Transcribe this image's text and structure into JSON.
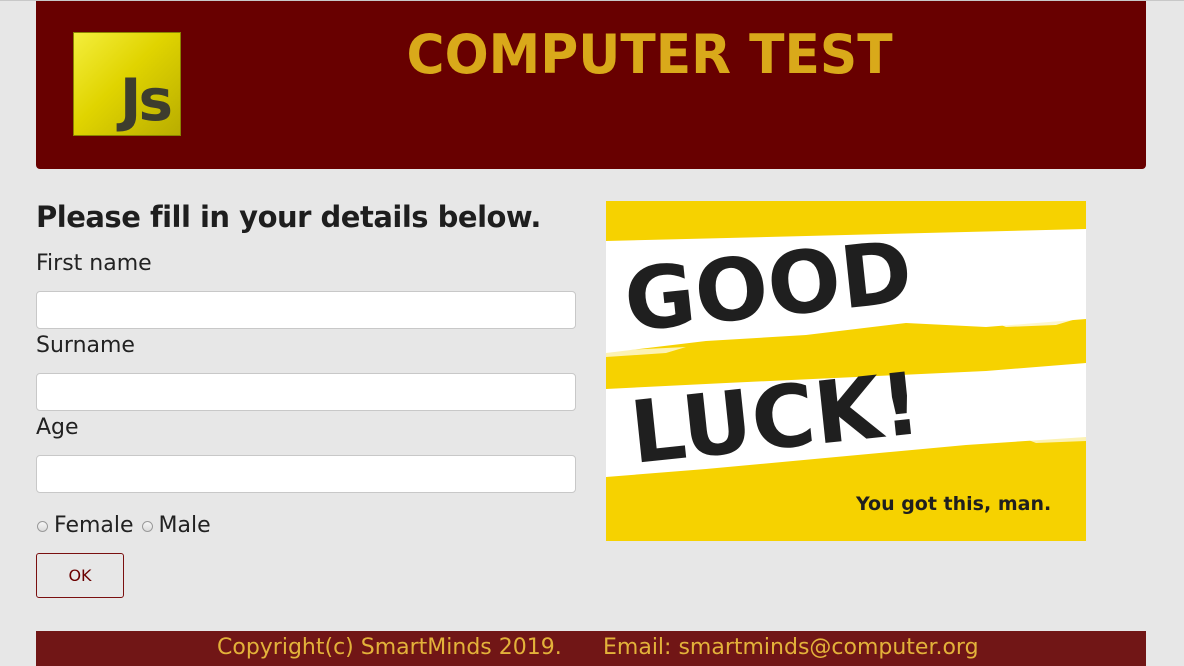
{
  "header": {
    "logo_text": "Js",
    "title": "COMPUTER TEST"
  },
  "form": {
    "heading": "Please fill in your details below.",
    "first_name_label": "First name",
    "first_name_value": "",
    "surname_label": "Surname",
    "surname_value": "",
    "age_label": "Age",
    "age_value": "",
    "gender_options": [
      "Female",
      "Male"
    ],
    "ok_label": "OK"
  },
  "image": {
    "headline_1": "GOOD",
    "headline_2": "LUCK!",
    "tagline": "You got this, man."
  },
  "footer": {
    "copyright": "Copyright(c) SmartMinds 2019.",
    "email": "Email: smartminds@computer.org"
  },
  "colors": {
    "header_bg": "#680000",
    "title_gold": "#d9a91a",
    "footer_bg": "#711616",
    "page_bg": "#e7e7e7",
    "goodluck_yellow": "#f6d200"
  }
}
